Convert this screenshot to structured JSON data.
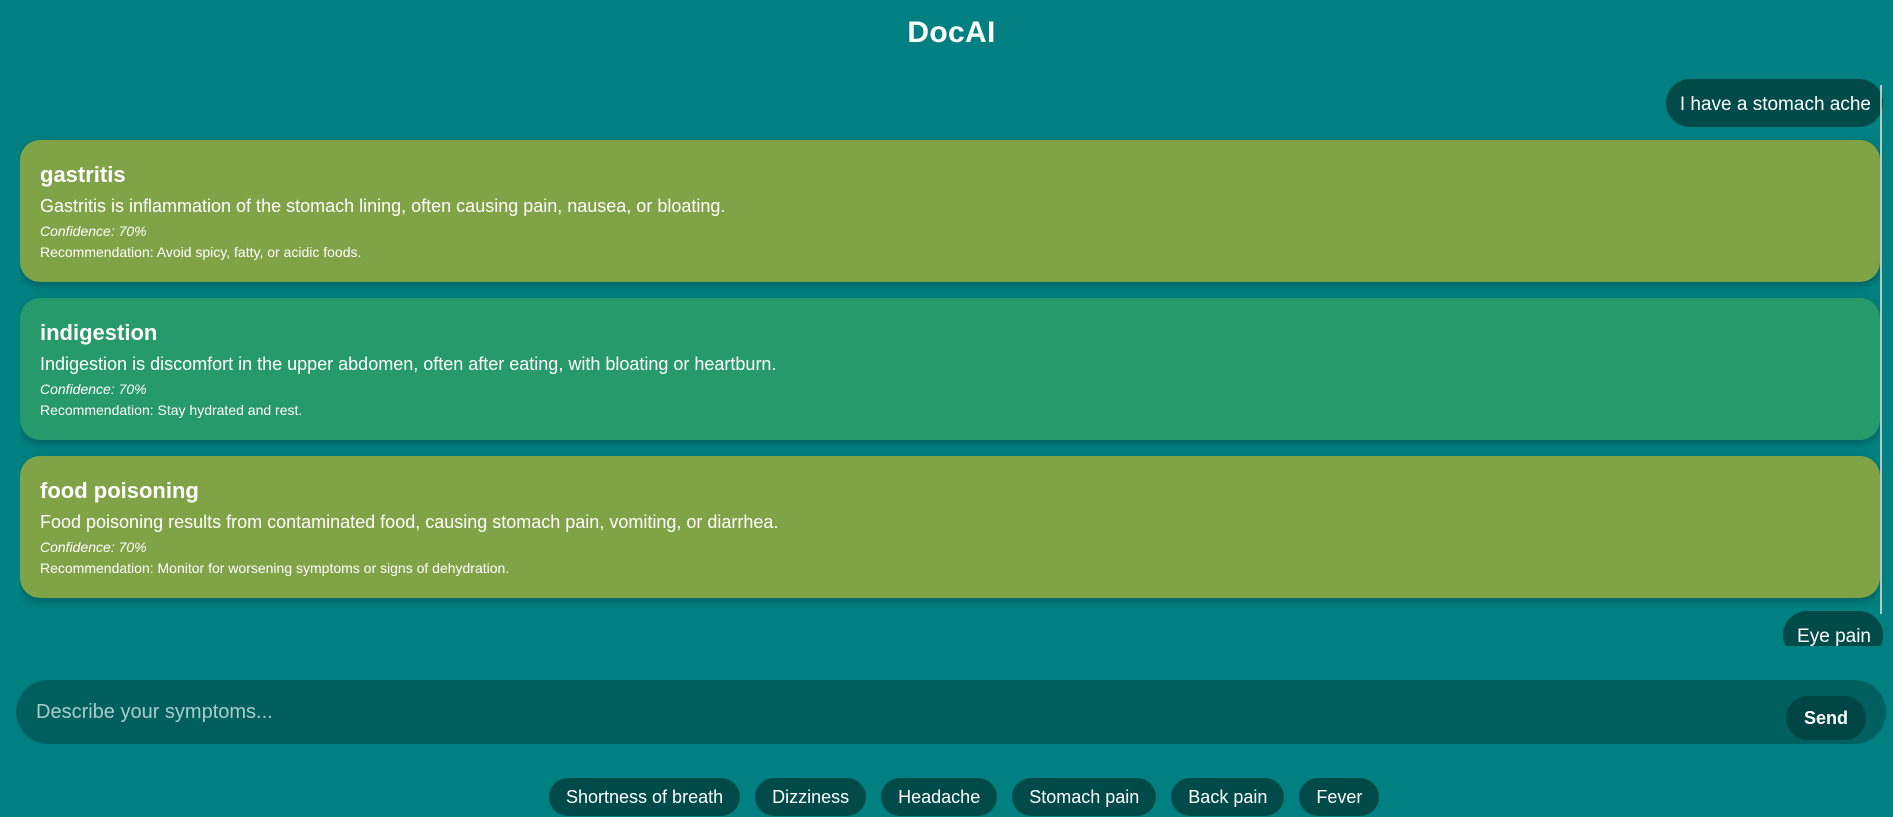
{
  "app": {
    "title": "DocAI"
  },
  "colors": {
    "background": "#008080",
    "user_bubble": "#004a4a",
    "card_olive": "#80a347",
    "card_green": "#269a6a",
    "input_bar": "#005f5f"
  },
  "messages": {
    "user_1": "I have a stomach ache",
    "user_2": "Eye pain"
  },
  "results": [
    {
      "title": "gastritis",
      "description": "Gastritis is inflammation of the stomach lining, often causing pain, nausea, or bloating.",
      "confidence": "Confidence: 70%",
      "recommendation": "Recommendation: Avoid spicy, fatty, or acidic foods.",
      "color": "#80a347"
    },
    {
      "title": "indigestion",
      "description": "Indigestion is discomfort in the upper abdomen, often after eating, with bloating or heartburn.",
      "confidence": "Confidence: 70%",
      "recommendation": "Recommendation: Stay hydrated and rest.",
      "color": "#269a6a"
    },
    {
      "title": "food poisoning",
      "description": "Food poisoning results from contaminated food, causing stomach pain, vomiting, or diarrhea.",
      "confidence": "Confidence: 70%",
      "recommendation": "Recommendation: Monitor for worsening symptoms or signs of dehydration.",
      "color": "#80a347"
    }
  ],
  "input": {
    "placeholder": "Describe your symptoms...",
    "value": "",
    "send_label": "Send"
  },
  "quick_symptoms": [
    "Shortness of breath",
    "Dizziness",
    "Headache",
    "Stomach pain",
    "Back pain",
    "Fever"
  ]
}
